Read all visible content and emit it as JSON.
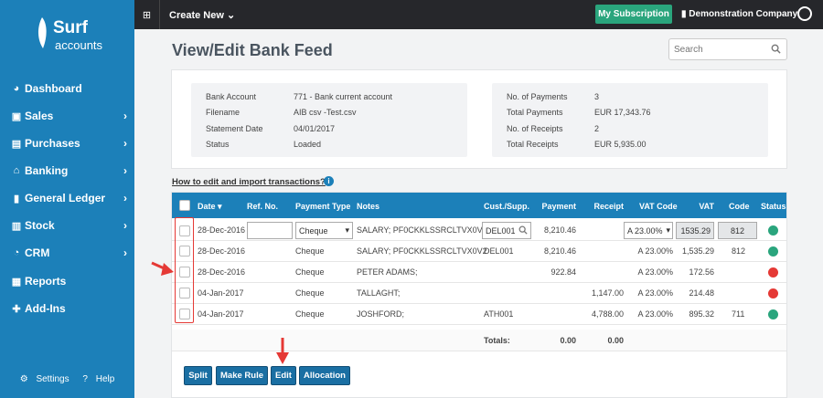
{
  "brand": {
    "line1": "Surf",
    "line2": "accounts"
  },
  "sidebar": {
    "items": [
      {
        "label": "Dashboard",
        "icon": "dashboard-icon",
        "glyph": "◕",
        "chev": ""
      },
      {
        "label": "Sales",
        "icon": "briefcase-icon",
        "glyph": "▣",
        "chev": "›"
      },
      {
        "label": "Purchases",
        "icon": "list-icon",
        "glyph": "▤",
        "chev": "›"
      },
      {
        "label": "Banking",
        "icon": "bank-icon",
        "glyph": "⌂",
        "chev": "›"
      },
      {
        "label": "General Ledger",
        "icon": "book-icon",
        "glyph": "▮",
        "chev": "›"
      },
      {
        "label": "Stock",
        "icon": "bar-chart-icon",
        "glyph": "▥",
        "chev": "›"
      },
      {
        "label": "CRM",
        "icon": "pie-chart-icon",
        "glyph": "◔",
        "chev": "›"
      },
      {
        "label": "Reports",
        "icon": "table-icon",
        "glyph": "▦",
        "chev": ""
      },
      {
        "label": "Add-Ins",
        "icon": "puzzle-icon",
        "glyph": "✚",
        "chev": ""
      }
    ],
    "settings": "Settings",
    "help": "Help"
  },
  "topbar": {
    "create": "Create New",
    "subscription": "My Subscription",
    "company": "Demonstration Company"
  },
  "page": {
    "title": "View/Edit Bank Feed",
    "search_placeholder": "Search"
  },
  "info": {
    "left": [
      {
        "label": "Bank Account",
        "value": "771 - Bank current account"
      },
      {
        "label": "Filename",
        "value": "AIB csv -Test.csv"
      },
      {
        "label": "Statement Date",
        "value": "04/01/2017"
      },
      {
        "label": "Status",
        "value": "Loaded"
      }
    ],
    "right": [
      {
        "label": "No. of Payments",
        "value": "3"
      },
      {
        "label": "Total Payments",
        "value": "EUR 17,343.76"
      },
      {
        "label": "No. of Receipts",
        "value": "2"
      },
      {
        "label": "Total Receipts",
        "value": "EUR 5,935.00"
      }
    ]
  },
  "howto": "How to edit and import transactions?",
  "table": {
    "headers": {
      "date": "Date",
      "ref": "Ref. No.",
      "ptype": "Payment Type",
      "notes": "Notes",
      "cust": "Cust./Supp.",
      "payment": "Payment",
      "receipt": "Receipt",
      "vatcode": "VAT Code",
      "vat": "VAT",
      "code": "Code",
      "status": "Status"
    },
    "rows": [
      {
        "date": "28-Dec-2016",
        "ref": "",
        "ptype": "Cheque",
        "notes": "SALARY; PF0CKKLSSRCLTVX0V2",
        "cust": "DEL001",
        "payment": "8,210.46",
        "receipt": "",
        "vatcode": "A 23.00%",
        "vat": "1535.29",
        "code": "812",
        "status": "#2aa57d"
      },
      {
        "date": "28-Dec-2016",
        "ref": "",
        "ptype": "Cheque",
        "notes": "SALARY; PF0CKKLSSRCLTVX0V2",
        "cust": "DEL001",
        "payment": "8,210.46",
        "receipt": "",
        "vatcode": "A 23.00%",
        "vat": "1,535.29",
        "code": "812",
        "status": "#2aa57d"
      },
      {
        "date": "28-Dec-2016",
        "ref": "",
        "ptype": "Cheque",
        "notes": "PETER ADAMS;",
        "cust": "",
        "payment": "922.84",
        "receipt": "",
        "vatcode": "A 23.00%",
        "vat": "172.56",
        "code": "",
        "status": "#e53935"
      },
      {
        "date": "04-Jan-2017",
        "ref": "",
        "ptype": "Cheque",
        "notes": "TALLAGHT;",
        "cust": "",
        "payment": "",
        "receipt": "1,147.00",
        "vatcode": "A 23.00%",
        "vat": "214.48",
        "code": "",
        "status": "#e53935"
      },
      {
        "date": "04-Jan-2017",
        "ref": "",
        "ptype": "Cheque",
        "notes": "JOSHFORD;",
        "cust": "ATH001",
        "payment": "",
        "receipt": "4,788.00",
        "vatcode": "A 23.00%",
        "vat": "895.32",
        "code": "711",
        "status": "#2aa57d"
      }
    ],
    "totals": {
      "label": "Totals:",
      "payment": "0.00",
      "receipt": "0.00"
    }
  },
  "buttons": {
    "split": "Split",
    "make_rule": "Make Rule",
    "edit": "Edit",
    "allocation": "Allocation"
  },
  "colors": {
    "sidebar": "#1c80b9",
    "topbar": "#26272b",
    "accent_green": "#2aa57d",
    "status_red": "#e53935",
    "button": "#1a6fa3"
  }
}
